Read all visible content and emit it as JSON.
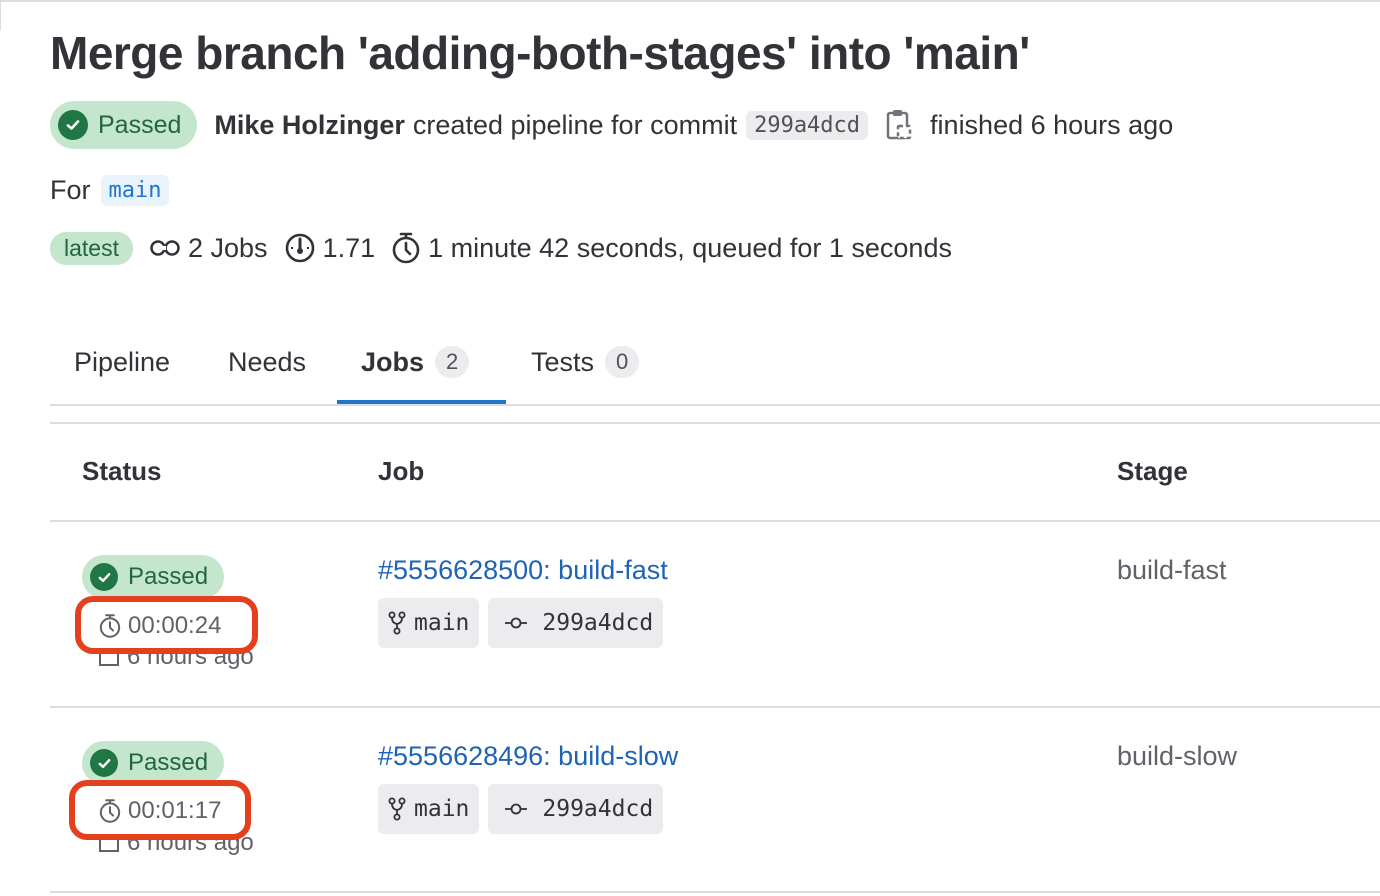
{
  "pipeline": {
    "title": "Merge branch 'adding-both-stages' into 'main'",
    "status_label": "Passed",
    "author": "Mike Holzinger",
    "created_text": "created pipeline for commit",
    "commit_sha": "299a4dcd",
    "finished_text": "finished 6 hours ago",
    "for_label": "For",
    "ref": "main",
    "latest_badge": "latest",
    "jobs_count_text": "2 Jobs",
    "compute_minutes": "1.71",
    "duration_text": "1 minute 42 seconds, queued for 1 seconds"
  },
  "tabs": [
    {
      "label": "Pipeline"
    },
    {
      "label": "Needs"
    },
    {
      "label": "Jobs",
      "count": "2",
      "active": true
    },
    {
      "label": "Tests",
      "count": "0"
    }
  ],
  "table": {
    "headers": {
      "status": "Status",
      "job": "Job",
      "stage": "Stage"
    },
    "rows": [
      {
        "status": "Passed",
        "duration": "00:00:24",
        "finished": "6 hours ago",
        "job": "#5556628500: build-fast",
        "ref": "main",
        "sha": "299a4dcd",
        "stage": "build-fast"
      },
      {
        "status": "Passed",
        "duration": "00:01:17",
        "finished": "6 hours ago",
        "job": "#5556628496: build-slow",
        "ref": "main",
        "sha": "299a4dcd",
        "stage": "build-slow"
      }
    ]
  },
  "colors": {
    "success_bg": "#c3e6cd",
    "success_icon": "#217645",
    "link": "#1f63b5",
    "tab_active_underline": "#1f75cb",
    "annotation_highlight": "#e5401d"
  }
}
